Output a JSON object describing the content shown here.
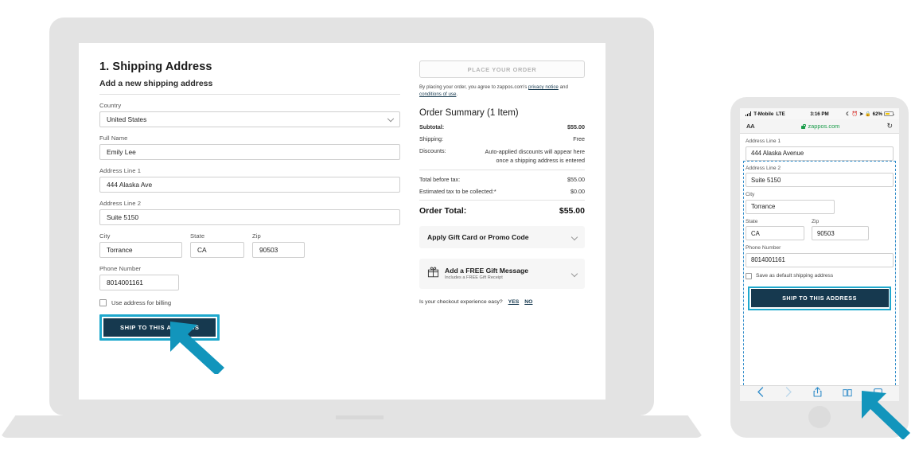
{
  "desktop": {
    "heading": "1. Shipping Address",
    "subheading": "Add a new shipping address",
    "fields": {
      "country_label": "Country",
      "country_value": "United States",
      "fullname_label": "Full Name",
      "fullname_value": "Emily Lee",
      "address1_label": "Address Line 1",
      "address1_value": "444 Alaska Ave",
      "address2_label": "Address Line 2",
      "address2_value": "Suite 5150",
      "city_label": "City",
      "city_value": "Torrance",
      "state_label": "State",
      "state_value": "CA",
      "zip_label": "Zip",
      "zip_value": "90503",
      "phone_label": "Phone Number",
      "phone_value": "8014001161"
    },
    "billing_checkbox_label": "Use address for billing",
    "ship_button": "SHIP TO THIS ADDRESS"
  },
  "summary": {
    "place_order_button": "PLACE YOUR ORDER",
    "legal_prefix": "By placing your order, you agree to zappos.com's ",
    "legal_link1": "privacy notice",
    "legal_mid": " and ",
    "legal_link2": "conditions of use",
    "legal_suffix": ".",
    "title": "Order Summary (1 Item)",
    "rows": [
      {
        "label": "Subtotal:",
        "value": "$55.00",
        "bold": true
      },
      {
        "label": "Shipping:",
        "value": "Free",
        "bold": false
      }
    ],
    "discounts_label": "Discounts:",
    "discounts_value": "Auto-applied discounts will appear here once a shipping address is entered",
    "total_before_tax_label": "Total before tax:",
    "total_before_tax_value": "$55.00",
    "tax_label": "Estimated tax to be collected:*",
    "tax_value": "$0.00",
    "order_total_label": "Order Total:",
    "order_total_value": "$55.00",
    "gift_card_accordion": "Apply Gift Card or Promo Code",
    "gift_message_title": "Add a FREE Gift Message",
    "gift_message_sub": "Includes a FREE Gift Receipt",
    "feedback_question": "Is your checkout experience easy?",
    "feedback_yes": "YES",
    "feedback_no": "NO"
  },
  "phone": {
    "status": {
      "carrier": "T-Mobile",
      "network": "LTE",
      "time": "3:16 PM",
      "battery": "62%"
    },
    "browser": {
      "aa_button": "AA",
      "url": "zappos.com"
    },
    "fields": {
      "address1_label": "Address Line 1",
      "address1_value": "444 Alaska Avenue",
      "address2_label": "Address Line 2",
      "address2_value": "Suite 5150",
      "city_label": "City",
      "city_value": "Torrance",
      "state_label": "State",
      "state_value": "CA",
      "zip_label": "Zip",
      "zip_value": "90503",
      "phone_label": "Phone Number",
      "phone_value": "8014001161"
    },
    "save_default_label": "Save as default shipping address",
    "ship_button": "SHIP TO THIS ADDRESS"
  },
  "colors": {
    "accent_cyan": "#1ea8cd",
    "button_navy": "#16394f",
    "dashed_blue": "#2e8bc9",
    "device_grey": "#e3e3e3",
    "link_green": "#1a9c4a",
    "battery_yellow": "#f2c400"
  }
}
